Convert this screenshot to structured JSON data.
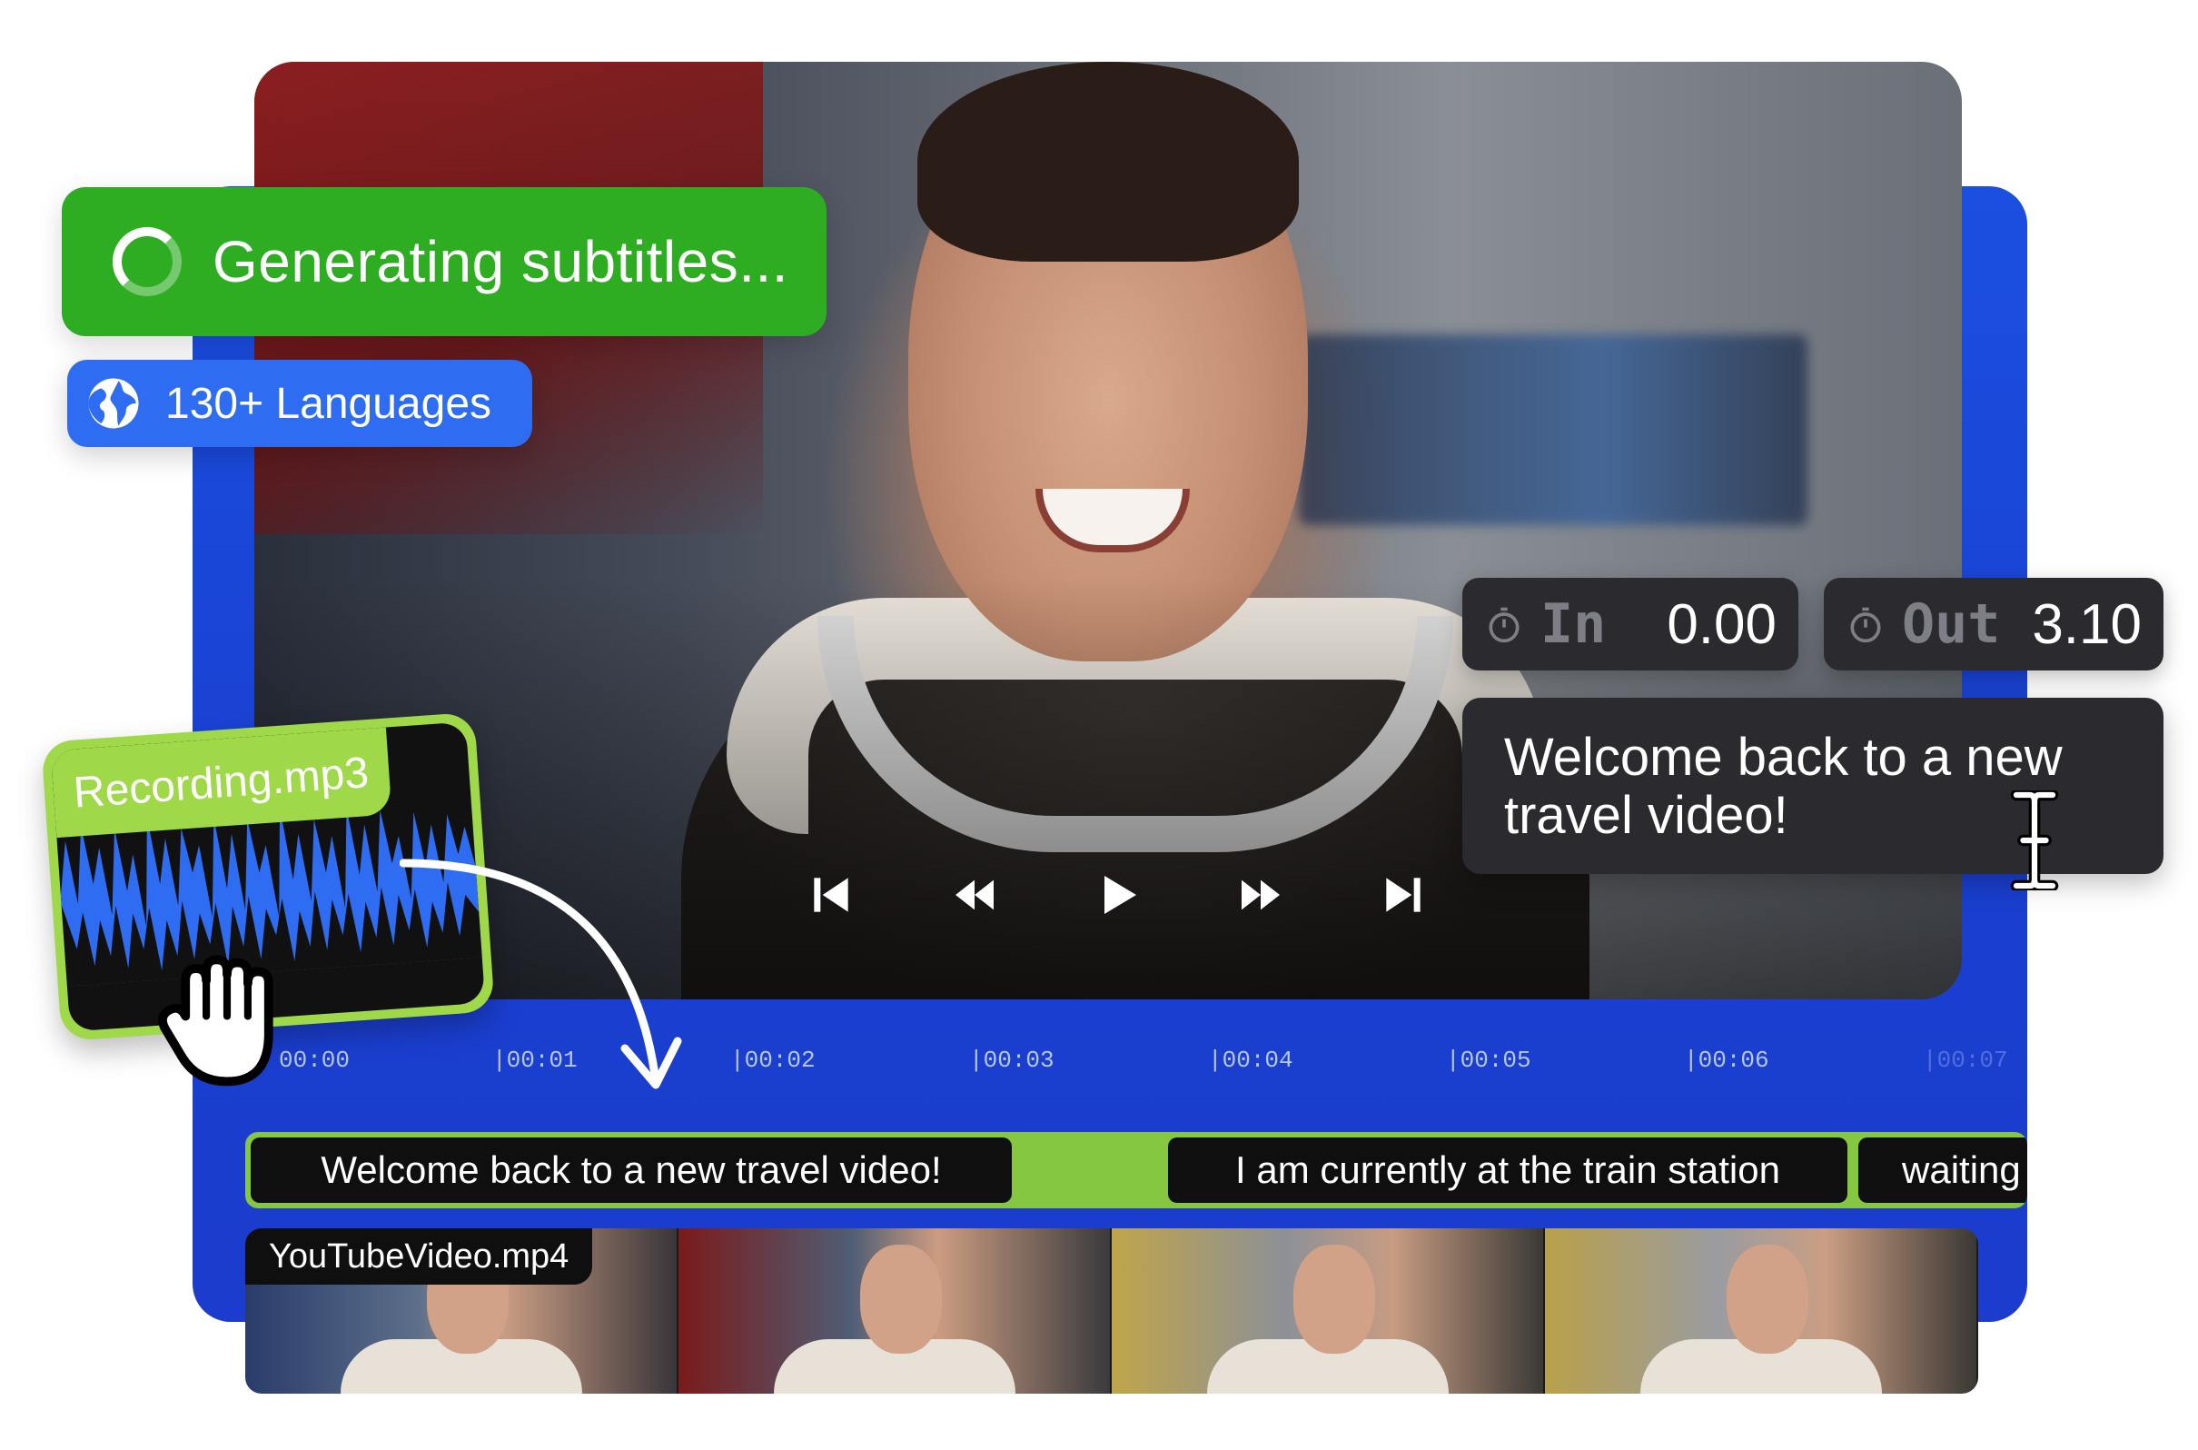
{
  "status": {
    "text": "Generating subtitles..."
  },
  "languages": {
    "text": "130+ Languages"
  },
  "timing": {
    "in_label": "In",
    "in_value": "0.00",
    "out_label": "Out",
    "out_value": "3.10"
  },
  "caption_editor": {
    "text": "Welcome back to a new travel video!"
  },
  "audio_file": {
    "name": "Recording.mp3"
  },
  "timeline": {
    "ticks": [
      "00:00",
      "|00:01",
      "|00:02",
      "|00:03",
      "|00:04",
      "|00:05",
      "|00:06",
      "|00:07"
    ]
  },
  "subtitle_track": {
    "clips": [
      "Welcome back to a new travel video!",
      "I am currently at the train station",
      "waiting"
    ]
  },
  "video_track": {
    "name": "YouTubeVideo.mp4"
  },
  "colors": {
    "panel_blue": "#1b4fe0",
    "status_green": "#2fad22",
    "language_blue": "#2e6df2",
    "track_green": "#86c742",
    "audio_green": "#9fd94a",
    "chip_dark": "#2b2b2f"
  },
  "icons": {
    "spinner": "loading-spinner-icon",
    "globe": "globe-icon",
    "stopwatch": "stopwatch-icon",
    "ibeam": "text-cursor-icon",
    "hand": "grab-hand-icon",
    "arrow": "curved-arrow-icon"
  }
}
